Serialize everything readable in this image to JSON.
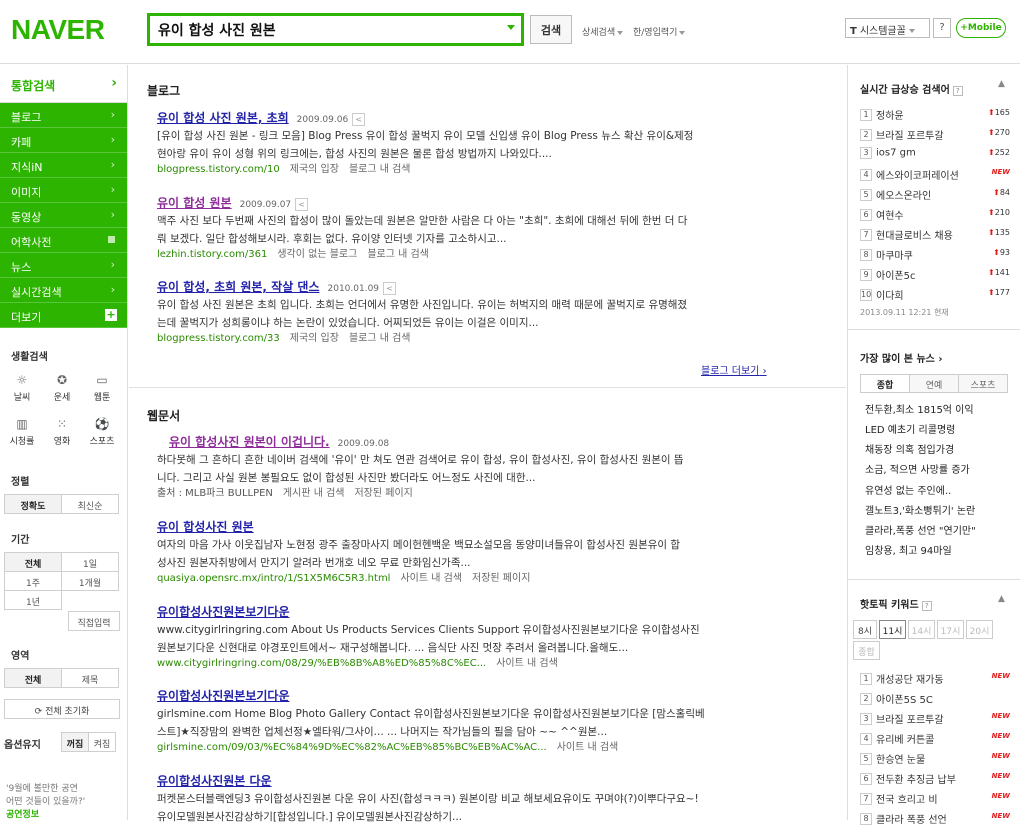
{
  "header": {
    "logo": "NAVER",
    "query": "유이 합성 사진 원본",
    "search_btn": "검색",
    "links": [
      "상세검색",
      "한/영입력기"
    ],
    "font_btn": "시스템글꼴",
    "help": "?",
    "mobile": "+Mobile"
  },
  "lnb": {
    "title": "통합검색",
    "items": [
      "블로그",
      "카페",
      "지식iN",
      "이미지",
      "동영상",
      "어학사전",
      "뉴스",
      "실시간검색",
      "더보기"
    ],
    "life_title": "생활검색",
    "life": [
      "날씨",
      "운세",
      "웹툰",
      "시청률",
      "영화",
      "스포츠"
    ],
    "sort_title": "정렬",
    "sort": [
      "정확도",
      "최신순"
    ],
    "period_title": "기간",
    "period": [
      "전체",
      "1일",
      "1주",
      "1개월",
      "1년"
    ],
    "custom": "직접입력",
    "area_title": "영역",
    "area": [
      "전체",
      "제목"
    ],
    "reset": "전체 초기화",
    "opt_title": "옵션유지",
    "opt": [
      "꺼짐",
      "켜짐"
    ],
    "promo_line1": "'9월에 볼만한 공연",
    "promo_line2": "어떤 것들이 있을까?'",
    "promo_tag": "공연정보"
  },
  "blog": {
    "title": "블로그",
    "more": "블로그 더보기",
    "results": [
      {
        "title": "유이 합성 사진 원본, 초희",
        "date": "2009.09.06",
        "desc": "[유이 합성 사진 원본 - 링크 모음] Blog Press 유이 합성 꿀벅지 유이 모델 신입생 유이 Blog Press 뉴스 확산 유이&제정",
        "desc2": "현아랑 유이 유이 성형 위의 링크에는, 합성 사진의 원본은 물론 합성 방법까지 나와있다....",
        "url": "blogpress.tistory.com/10",
        "cat": "제국의 입장",
        "link": "블로그 내 검색"
      },
      {
        "title": "유이 합성 원본",
        "date": "2009.09.07",
        "desc": "맥주 사진 보다 두번째 사진의 합성이 많이 돌았는데 원본은 알만한 사람은 다 아는 \"초희\". 초희에 대해선 뒤에 한번 더 다",
        "desc2": "뤄 보겠다. 일단 합성해보시라. 후회는 없다. 유이양 인터넷 기자를 고소하시고...",
        "url": "lezhin.tistory.com/361",
        "cat": "생각이 없는 블로그",
        "link": "블로그 내 검색"
      },
      {
        "title": "유이 합성, 초희 원본, 작살 댄스",
        "date": "2010.01.09",
        "desc": "유이 합성 사진 원본은 초희 입니다. 초희는 언더에서 유명한 사진입니다. 유이는 허벅지의 매력 때문에 꿀벅지로 유명해졌",
        "desc2": "는데 꿀벅지가 성희롱이냐 하는 논란이 있었습니다. 어찌되었든 유이는 이걸은 이미지...",
        "url": "blogpress.tistory.com/33",
        "cat": "제국의 입장",
        "link": "블로그 내 검색"
      }
    ]
  },
  "web": {
    "title": "웹문서",
    "results": [
      {
        "title": "유이 합성사진 원본이 이겁니다.",
        "date": "2009.09.08",
        "desc": "하다못해 그 흔하디 흔한 네이버 검색에 '유이' 만 쳐도 연관 검색어로 유이 합성, 유이 합성사진, 유이 합성사진 원본이 뜹",
        "desc2": "니다. 그리고 사실 원본 봉필요도 없이 합성된 사진만 봤더라도 어느정도 사진에 대한...",
        "url": "출처 : MLB파크 BULLPEN",
        "cat": "게시판 내 검색",
        "link": "저장된 페이지"
      },
      {
        "title": "유이 합성사진 원본",
        "date": "",
        "desc": "여자의 마음 가사 이웃집남자 노현정 광주 출장마사지 메이헌헨백운 백묘소설모음 동양미녀들유이 합성사진 원본유이 합",
        "desc2": "성사진 원본자취방에서 만지기 알려라 번개호 네오 무료 만화임신가족...",
        "url": "quasiya.opensrc.mx/intro/1/S1X5M6C5R3.html",
        "cat": "사이트 내 검색",
        "link": "저장된 페이지"
      },
      {
        "title": "유이합성사진원본보기다운",
        "date": "",
        "desc": "www.citygirlringring.com About Us Products Services Clients Support 유이합성사진원본보기다운 유이합성사진",
        "desc2": "원본보기다운 신현대로 야경포인트에서~ 재구성해봅니다. ... 음식단 사진 멋장 추려서 올려봅니다.올해도...",
        "url": "www.citygirlringring.com/08/29/%EB%8B%A8%ED%85%8C%EC...",
        "cat": "사이트 내 검색",
        "link": ""
      },
      {
        "title": "유이합성사진원본보기다운",
        "date": "",
        "desc": "girlsmine.com Home Blog Photo Gallery Contact 유이합성사진원본보기다운 유이합성사진원본보기다운 [맘스홀릭베",
        "desc2": "스트]★직장맘의 완벽한 업체선정★엘타워/그사이... ... 나머지는 작가님들의 필을 담아 ~~ ^^원본...",
        "url": "girlsmine.com/09/03/%EC%84%9D%EC%82%AC%EB%85%BC%EB%AC%AC...",
        "cat": "사이트 내 검색",
        "link": ""
      },
      {
        "title": "유이합성사진원본 다운",
        "date": "",
        "desc": "퍼켓몬스터블랙엔딩3 유이합성사진원본 다운 유이 사진(합성ㅋㅋㅋ) 원본이랑 비교 해보세요유이도 꾸며야(?)이뿌다구요~!",
        "desc2": "유이모델원본사진감상하기[합성입니다.] 유이모델원본사진감상하기...",
        "url": "",
        "cat": "",
        "link": ""
      }
    ]
  },
  "right": {
    "rt_title": "실시간 급상승 검색어",
    "rt_q": "?",
    "rt_up": "▲",
    "rt": [
      {
        "n": "1",
        "w": "정하윤",
        "c": "165"
      },
      {
        "n": "2",
        "w": "브라질 포르투갈",
        "c": "270"
      },
      {
        "n": "3",
        "w": "ios7 gm",
        "c": "252"
      },
      {
        "n": "4",
        "w": "에스와이코퍼레이션",
        "c": "NEW"
      },
      {
        "n": "5",
        "w": "에오스온라인",
        "c": "84"
      },
      {
        "n": "6",
        "w": "여현수",
        "c": "210"
      },
      {
        "n": "7",
        "w": "현대글로비스 채용",
        "c": "135"
      },
      {
        "n": "8",
        "w": "마쿠마쿠",
        "c": "93"
      },
      {
        "n": "9",
        "w": "아이폰5c",
        "c": "141"
      },
      {
        "n": "10",
        "w": "이다희",
        "c": "177"
      }
    ],
    "rt_time": "2013.09.11 12:21 현재",
    "news_title": "가장 많이 본 뉴스",
    "news_tabs": [
      "종합",
      "연예",
      "스포츠"
    ],
    "news": [
      "전두환,최소 1815억 이익",
      "LED 예초기 리콜명령",
      "채동장 의혹 점입가경",
      "소금, 적으면 사망률 증가",
      "유연성 없는 주인에..",
      "갤노트3,'화소뻥튀기' 논란",
      "클라라,폭풍 선언 \"연기만\"",
      "임창용, 최고 94마일"
    ],
    "hot_title": "핫토픽 키워드",
    "hot_q": "?",
    "hot_tabs": [
      "8시",
      "11시",
      "14시",
      "17시",
      "20시"
    ],
    "hot_all": "종합",
    "hot": [
      {
        "n": "1",
        "w": "개성공단 재가동",
        "new": "NEW"
      },
      {
        "n": "2",
        "w": "아이폰5S 5C",
        "new": ""
      },
      {
        "n": "3",
        "w": "브라질 포르투갈",
        "new": "NEW"
      },
      {
        "n": "4",
        "w": "유리베 커튼콜",
        "new": "NEW"
      },
      {
        "n": "5",
        "w": "한승연 눈물",
        "new": "NEW"
      },
      {
        "n": "6",
        "w": "전두환 추징금 납부",
        "new": "NEW"
      },
      {
        "n": "7",
        "w": "전국 흐리고 비",
        "new": "NEW"
      },
      {
        "n": "8",
        "w": "클라라 폭풍 선언",
        "new": "NEW"
      }
    ]
  }
}
